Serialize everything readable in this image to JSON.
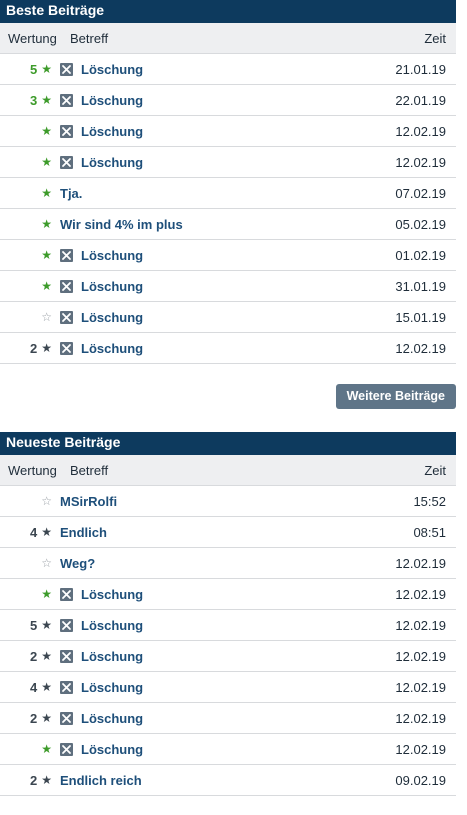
{
  "best": {
    "title": "Beste Beiträge",
    "col_rating": "Wertung",
    "col_subject": "Betreff",
    "col_time": "Zeit",
    "more_label": "Weitere Beiträge",
    "rows": [
      {
        "num": "5",
        "star": "green",
        "icon": true,
        "subject": "Löschung",
        "time": "21.01.19"
      },
      {
        "num": "3",
        "star": "green",
        "icon": true,
        "subject": "Löschung",
        "time": "22.01.19"
      },
      {
        "num": "",
        "star": "green",
        "icon": true,
        "subject": "Löschung",
        "time": "12.02.19"
      },
      {
        "num": "",
        "star": "green",
        "icon": true,
        "subject": "Löschung",
        "time": "12.02.19"
      },
      {
        "num": "",
        "star": "green",
        "icon": false,
        "subject": "Tja.",
        "time": "07.02.19"
      },
      {
        "num": "",
        "star": "green",
        "icon": false,
        "subject": "Wir sind 4% im plus",
        "time": "05.02.19"
      },
      {
        "num": "",
        "star": "green",
        "icon": true,
        "subject": "Löschung",
        "time": "01.02.19"
      },
      {
        "num": "",
        "star": "green",
        "icon": true,
        "subject": "Löschung",
        "time": "31.01.19"
      },
      {
        "num": "",
        "star": "empty",
        "icon": true,
        "subject": "Löschung",
        "time": "15.01.19"
      },
      {
        "num": "2",
        "star": "dark",
        "icon": true,
        "subject": "Löschung",
        "time": "12.02.19"
      }
    ]
  },
  "newest": {
    "title": "Neueste Beiträge",
    "col_rating": "Wertung",
    "col_subject": "Betreff",
    "col_time": "Zeit",
    "rows": [
      {
        "num": "",
        "star": "empty",
        "icon": false,
        "subject": "MSirRolfi",
        "time": "15:52"
      },
      {
        "num": "4",
        "star": "dark",
        "icon": false,
        "subject": "Endlich",
        "time": "08:51"
      },
      {
        "num": "",
        "star": "empty",
        "icon": false,
        "subject": "Weg?",
        "time": "12.02.19"
      },
      {
        "num": "",
        "star": "green",
        "icon": true,
        "subject": "Löschung",
        "time": "12.02.19"
      },
      {
        "num": "5",
        "star": "dark",
        "icon": true,
        "subject": "Löschung",
        "time": "12.02.19"
      },
      {
        "num": "2",
        "star": "dark",
        "icon": true,
        "subject": "Löschung",
        "time": "12.02.19"
      },
      {
        "num": "4",
        "star": "dark",
        "icon": true,
        "subject": "Löschung",
        "time": "12.02.19"
      },
      {
        "num": "2",
        "star": "dark",
        "icon": true,
        "subject": "Löschung",
        "time": "12.02.19"
      },
      {
        "num": "",
        "star": "green",
        "icon": true,
        "subject": "Löschung",
        "time": "12.02.19"
      },
      {
        "num": "2",
        "star": "dark",
        "icon": false,
        "subject": "Endlich reich",
        "time": "09.02.19"
      }
    ]
  },
  "colors": {
    "header_bg": "#0d3a5e",
    "star_green": "#3d9b2a",
    "star_dark": "#3b4650",
    "link": "#1e4f7a",
    "button_bg": "#5f7588"
  },
  "icons": {
    "deleted": "x-box-icon",
    "star_filled": "star-icon",
    "star_empty": "star-outline-icon"
  }
}
